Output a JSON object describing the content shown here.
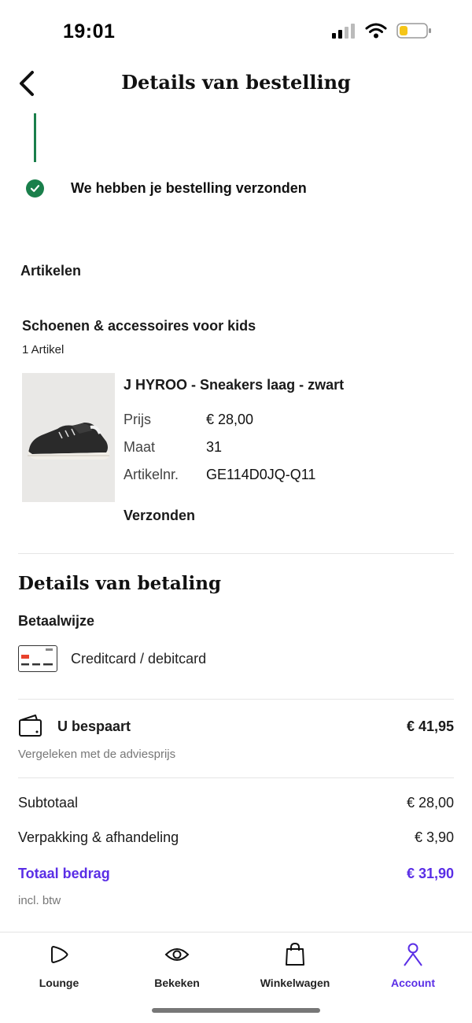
{
  "status_bar": {
    "time": "19:01"
  },
  "header": {
    "title": "Details van bestelling"
  },
  "order_status": {
    "text": "We hebben je bestelling verzonden"
  },
  "articles": {
    "section_label": "Artikelen",
    "category": "Schoenen & accessoires voor kids",
    "count": "1 Artikel",
    "product": {
      "title": "J HYROO  - Sneakers laag - zwart",
      "rows": [
        {
          "label": "Prijs",
          "value": "€ 28,00"
        },
        {
          "label": "Maat",
          "value": "31"
        },
        {
          "label": "Artikelnr.",
          "value": "GE114D0JQ-Q11"
        }
      ],
      "status": "Verzonden"
    }
  },
  "payment": {
    "title": "Details van betaling",
    "method_label": "Betaalwijze",
    "method": "Creditcard / debitcard"
  },
  "savings": {
    "label": "U bespaart",
    "amount": "€ 41,95",
    "note": "Vergeleken met de adviesprijs"
  },
  "totals": [
    {
      "label": "Subtotaal",
      "value": "€ 28,00"
    },
    {
      "label": "Verpakking & afhandeling",
      "value": "€ 3,90"
    },
    {
      "label": "Totaal bedrag",
      "value": "€ 31,90"
    }
  ],
  "vat_note": "incl. btw",
  "tabbar": {
    "tabs": [
      {
        "label": "Lounge",
        "icon": "play-icon"
      },
      {
        "label": "Bekeken",
        "icon": "eye-icon"
      },
      {
        "label": "Winkelwagen",
        "icon": "shopping-bag-icon"
      },
      {
        "label": "Account",
        "icon": "person-icon",
        "active": true
      }
    ]
  },
  "colors": {
    "accent": "#5a2ee6",
    "success": "#1a7f4b",
    "card_red": "#e8412c"
  }
}
